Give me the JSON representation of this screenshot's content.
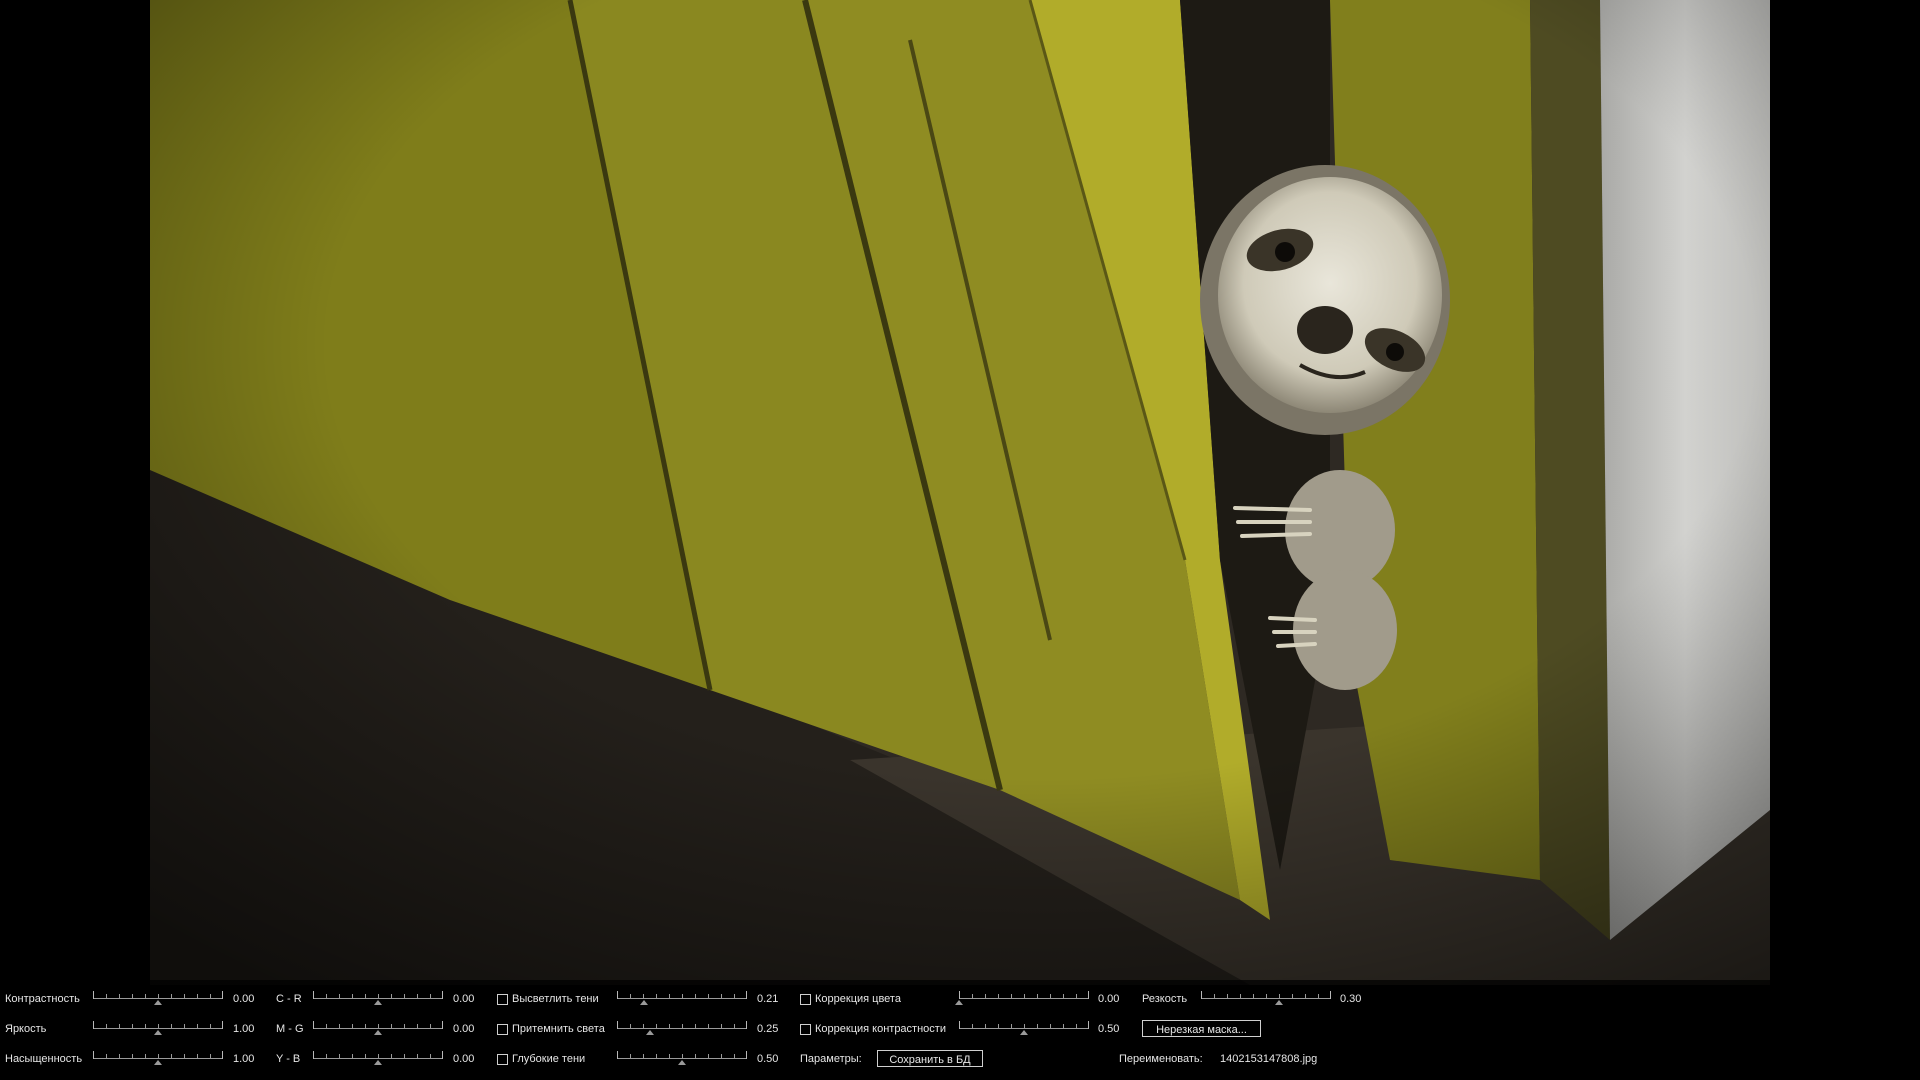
{
  "photo": {
    "subject": "sloth-peeking",
    "colors": {
      "board": "#8c8a1c",
      "floor": "#2e2923",
      "wall": "#c9c9c6"
    }
  },
  "sliders": [
    {
      "id": "contrast",
      "label": "Контрастность",
      "value": "0.00",
      "level": 0.5
    },
    {
      "id": "brightness",
      "label": "Яркость",
      "value": "1.00",
      "level": 0.5
    },
    {
      "id": "saturation",
      "label": "Насыщенность",
      "value": "1.00",
      "level": 0.5
    },
    {
      "id": "c-r",
      "label": "C - R",
      "value": "0.00",
      "level": 0.5
    },
    {
      "id": "m-g",
      "label": "M - G",
      "value": "0.00",
      "level": 0.5
    },
    {
      "id": "y-b",
      "label": "Y - B",
      "value": "0.00",
      "level": 0.5
    },
    {
      "id": "lighten-shadows",
      "label": "Высветлить тени",
      "value": "0.21",
      "level": 0.21
    },
    {
      "id": "darken-highlights",
      "label": "Притемнить света",
      "value": "0.25",
      "level": 0.25
    },
    {
      "id": "deep-shadows",
      "label": "Глубокие тени",
      "value": "0.50",
      "level": 0.5
    },
    {
      "id": "color-correction",
      "label": "Коррекция цвета",
      "value": "0.00",
      "level": 0.0
    },
    {
      "id": "contrast-correction",
      "label": "Коррекция контрастности",
      "value": "0.50",
      "level": 0.5
    },
    {
      "id": "sharpness",
      "label": "Резкость",
      "value": "0.30",
      "level": 0.6
    }
  ],
  "checkboxes": {
    "lighten_shadows": false,
    "darken_highlights": false,
    "deep_shadows": false,
    "color_correction": false,
    "contrast_correction": false
  },
  "params_label": "Параметры:",
  "save_button": "Сохранить в БД",
  "unsharp_button": "Нерезкая маска...",
  "rename_label": "Переименовать:",
  "filename": "1402153147808.jpg"
}
